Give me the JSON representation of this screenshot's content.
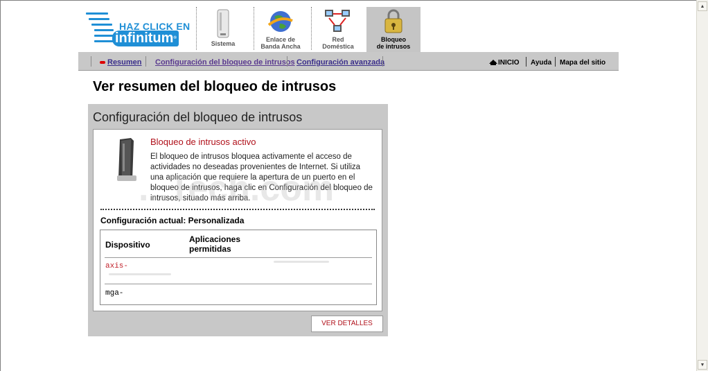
{
  "logo": {
    "line1": "HAZ CLICK EN",
    "line2": "infinitum",
    "mark": "®"
  },
  "tabs": [
    {
      "label1": "Sistema",
      "label2": "",
      "icon": "modem-icon"
    },
    {
      "label1": "Enlace de",
      "label2": "Banda Ancha",
      "icon": "globe-icon"
    },
    {
      "label1": "Red",
      "label2": "Doméstica",
      "icon": "network-icon"
    },
    {
      "label1": "Bloqueo",
      "label2": "de intrusos",
      "icon": "lock-icon",
      "active": true
    }
  ],
  "nav": {
    "summary": "Resumen",
    "config": "Configuración del bloqueo de intrusos",
    "advanced": "Configuración avanzada",
    "home": "INICIO",
    "help": "Ayuda",
    "sitemap": "Mapa del sitio"
  },
  "page_title": "Ver resumen del bloqueo de intrusos",
  "panel": {
    "title": "Configuración del bloqueo de intrusos",
    "status_title": "Bloqueo de intrusos activo",
    "status_text": "El bloqueo de intrusos bloquea activamente el acceso de actividades no deseadas provenientes de Internet. Si utiliza una aplicación que requiere la apertura de un puerto en el bloqueo de intrusos, haga clic en Configuración del bloqueo de intrusos, situado más arriba.",
    "current_config": "Configuración actual: Personalizada",
    "table": {
      "col_device": "Dispositivo",
      "col_apps_1": "Aplicaciones",
      "col_apps_2": "permitidas",
      "rows": [
        {
          "device": "axis-"
        },
        {
          "device": "mga-"
        }
      ]
    },
    "details_button": "VER DETALLES"
  },
  "watermark": "...Tech.com",
  "colors": {
    "accent_red": "#b0101a",
    "brand_blue": "#1f8fd6",
    "panel_gray": "#c8c8c8"
  }
}
